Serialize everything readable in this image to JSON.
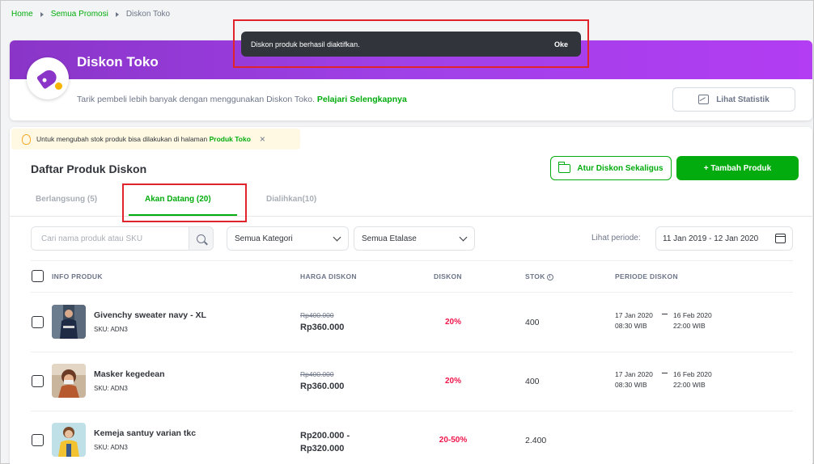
{
  "breadcrumb": {
    "home": "Home",
    "promo": "Semua Promosi",
    "current": "Diskon Toko"
  },
  "toast": {
    "message": "Diskon produk berhasil diaktifkan.",
    "action": "Oke"
  },
  "header": {
    "title": "Diskon Toko",
    "description": "Tarik pembeli lebih banyak dengan menggunakan Diskon Toko.",
    "learn_more": "Pelajari Selengkapnya",
    "stat_button": "Lihat Statistik",
    "banner_color": "#9b3ee0"
  },
  "notice": {
    "text": "Untuk mengubah stok produk bisa dilakukan di halaman",
    "link": "Produk Toko",
    "close": "×"
  },
  "list": {
    "title": "Daftar Produk Diskon",
    "bulk_button": "Atur Diskon Sekaligus",
    "add_button": "+ Tambah Produk"
  },
  "tabs": [
    {
      "label": "Berlangsung (5)"
    },
    {
      "label": "Akan Datang (20)"
    },
    {
      "label": "Dialihkan(10)"
    }
  ],
  "filters": {
    "search_placeholder": "Cari nama produk atau SKU",
    "category": "Semua Kategori",
    "showcase": "Semua Etalase",
    "period_label": "Lihat periode:",
    "period_value": "11 Jan 2019 - 12 Jan 2020"
  },
  "columns": {
    "info": "INFO PRODUK",
    "price": "HARGA DISKON",
    "discount": "DISKON",
    "stock": "STOK",
    "period": "PERIODE DISKON"
  },
  "rows": [
    {
      "name": "Givenchy sweater navy - XL",
      "sku": "SKU: ADN3",
      "original_price": "Rp400.000",
      "price": "Rp360.000",
      "discount": "20%",
      "stock": "400",
      "start_date": "17 Jan 2020",
      "start_time": "08:30 WIB",
      "end_date": "16 Feb 2020",
      "end_time": "22:00 WIB"
    },
    {
      "name": "Masker kegedean",
      "sku": "SKU: ADN3",
      "original_price": "Rp400.000",
      "price": "Rp360.000",
      "discount": "20%",
      "stock": "400",
      "start_date": "17 Jan 2020",
      "start_time": "08:30 WIB",
      "end_date": "16 Feb 2020",
      "end_time": "22:00 WIB"
    },
    {
      "name": "Kemeja santuy varian tkc",
      "sku": "SKU: ADN3",
      "price_from": "Rp200.000 -",
      "price_to": "Rp320.000",
      "discount": "20-50%",
      "stock": "2.400"
    }
  ],
  "colors": {
    "green": "#03ac0e",
    "discount_red": "#ef144a",
    "highlight": "#e1232b"
  }
}
